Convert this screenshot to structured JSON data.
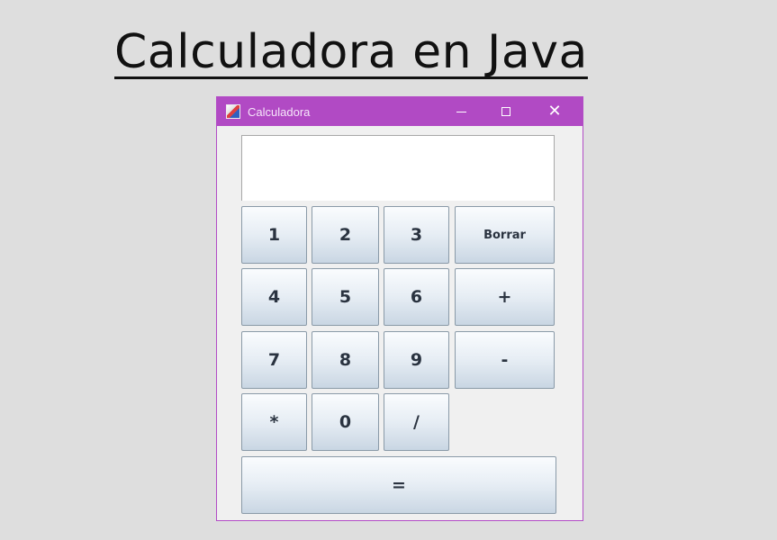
{
  "heading": "Calculadora en Java",
  "window": {
    "title": "Calculadora",
    "app_icon": "java-cup-icon",
    "controls": {
      "minimize": "minimize-icon",
      "maximize": "maximize-icon",
      "close": "close-icon"
    }
  },
  "display": {
    "value": ""
  },
  "keys": {
    "k1": "1",
    "k2": "2",
    "k3": "3",
    "borrar": "Borrar",
    "k4": "4",
    "k5": "5",
    "k6": "6",
    "plus": "+",
    "k7": "7",
    "k8": "8",
    "k9": "9",
    "minus": "-",
    "mul": "*",
    "k0": "0",
    "div": "/",
    "equals": "="
  },
  "colors": {
    "titlebar": "#b14ac4",
    "background": "#dedede",
    "window": "#f0f0f0"
  }
}
